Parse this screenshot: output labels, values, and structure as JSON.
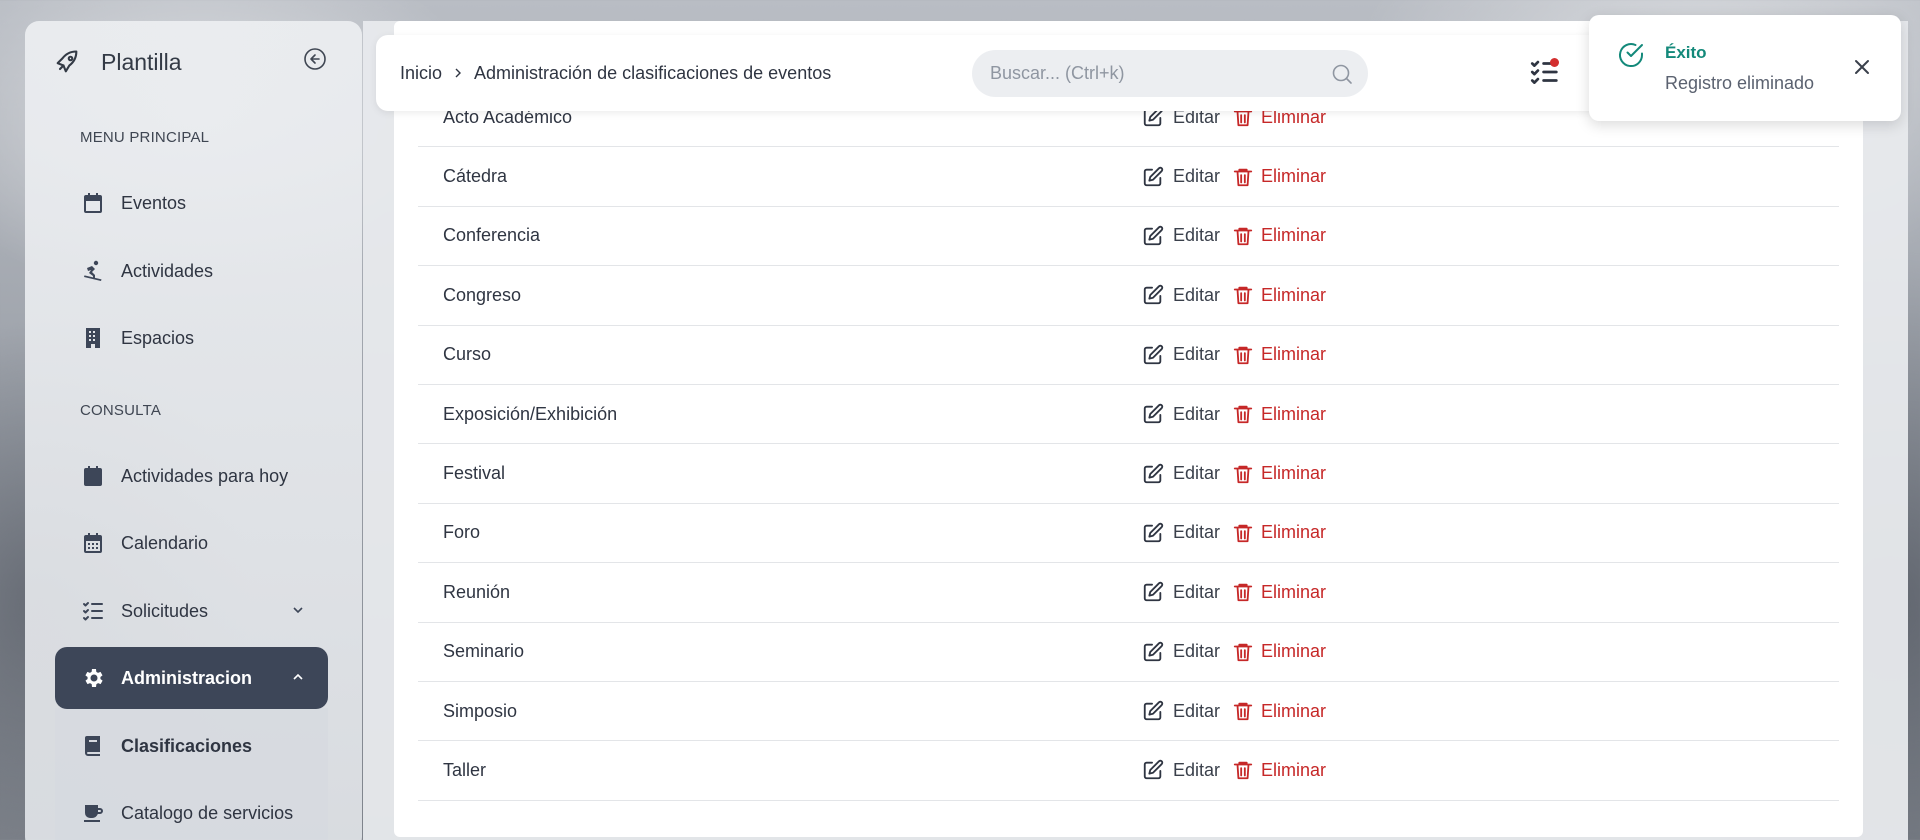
{
  "sidebar": {
    "brand": "Plantilla",
    "sections": [
      "MENU PRINCIPAL",
      "CONSULTA"
    ],
    "items": [
      {
        "label": "Eventos",
        "icon": "calendar-icon"
      },
      {
        "label": "Actividades",
        "icon": "snowboarding-icon"
      },
      {
        "label": "Espacios",
        "icon": "building-icon"
      },
      {
        "label": "Actividades para hoy",
        "icon": "calendar-day-icon"
      },
      {
        "label": "Calendario",
        "icon": "calendar-grid-icon"
      },
      {
        "label": "Solicitudes",
        "icon": "tasks-list-icon"
      },
      {
        "label": "Administracion",
        "icon": "gear-icon"
      }
    ],
    "subitems": [
      {
        "label": "Clasificaciones",
        "icon": "book-icon"
      },
      {
        "label": "Catalogo de servicios",
        "icon": "mug-icon"
      }
    ]
  },
  "header": {
    "breadcrumb_home": "Inicio",
    "breadcrumb_current": "Administración de clasificaciones de eventos",
    "search_placeholder": "Buscar... (Ctrl+k)"
  },
  "table": {
    "edit_label": "Editar",
    "delete_label": "Eliminar",
    "rows": [
      "Acto Académico",
      "Cátedra",
      "Conferencia",
      "Congreso",
      "Curso",
      "Exposición/Exhibición",
      "Festival",
      "Foro",
      "Reunión",
      "Seminario",
      "Simposio",
      "Taller"
    ]
  },
  "toast": {
    "title": "Éxito",
    "message": "Registro eliminado"
  },
  "colors": {
    "active_nav": "#3d4658",
    "danger": "#c62828",
    "success": "#13897a"
  }
}
